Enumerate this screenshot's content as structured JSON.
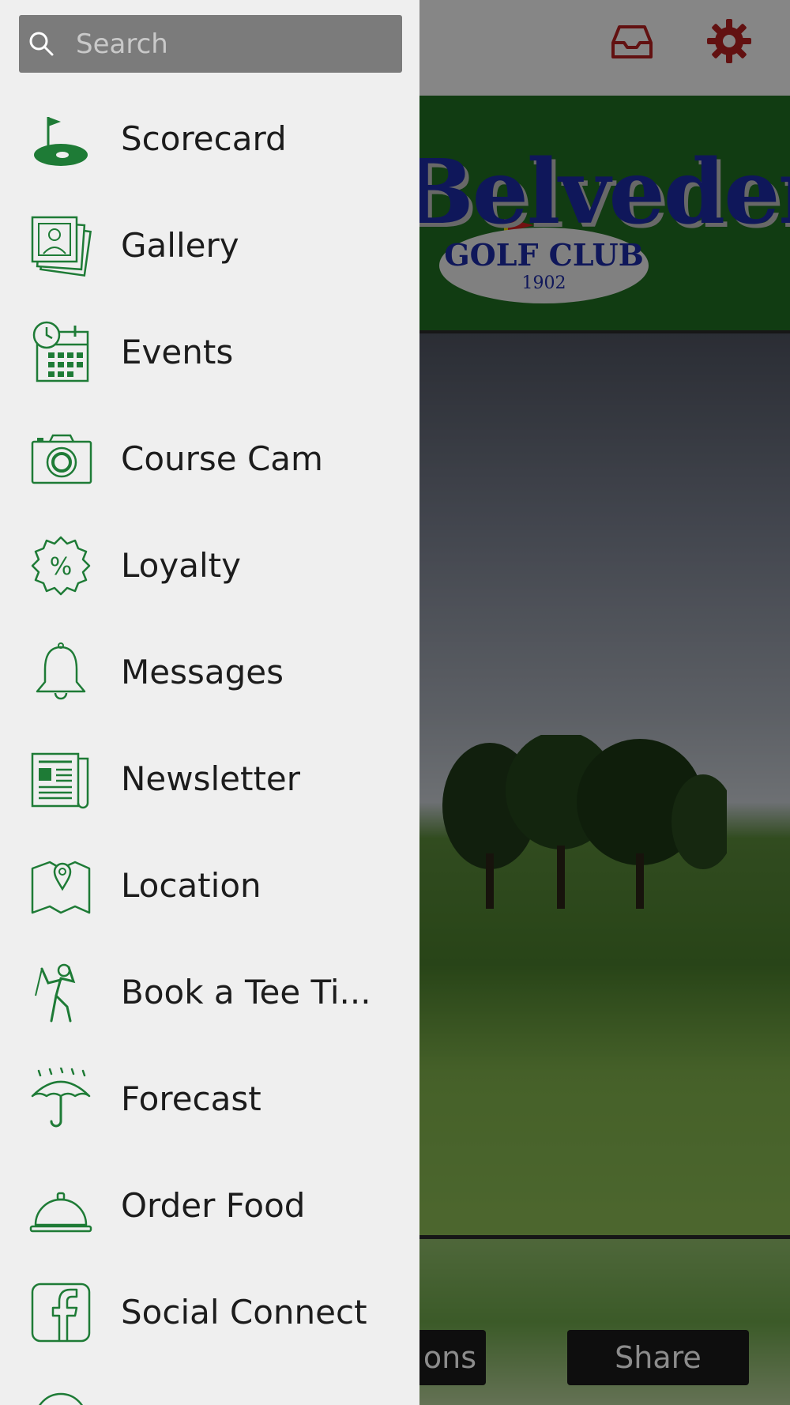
{
  "colors": {
    "accent_green": "#1e7b36",
    "header_icon_red": "#b21f1f",
    "drawer_bg": "#efefef",
    "search_bg": "#7b7b7b"
  },
  "header": {
    "inbox_icon": "inbox-icon",
    "settings_icon": "gear-icon"
  },
  "logo": {
    "wordmark": "Belvedere",
    "club": "GOLF CLUB",
    "year": "1902"
  },
  "search": {
    "placeholder": "Search",
    "value": ""
  },
  "menu": {
    "items": [
      {
        "label": "Scorecard",
        "icon": "golf-hole-flag-icon"
      },
      {
        "label": "Gallery",
        "icon": "photo-gallery-icon"
      },
      {
        "label": "Events",
        "icon": "calendar-clock-icon"
      },
      {
        "label": "Course Cam",
        "icon": "camera-icon"
      },
      {
        "label": "Loyalty",
        "icon": "percent-badge-icon"
      },
      {
        "label": "Messages",
        "icon": "bell-icon"
      },
      {
        "label": "Newsletter",
        "icon": "newspaper-icon"
      },
      {
        "label": "Location",
        "icon": "map-pin-icon"
      },
      {
        "label": "Book a Tee Ti...",
        "icon": "golfer-swing-icon"
      },
      {
        "label": "Forecast",
        "icon": "umbrella-rain-icon"
      },
      {
        "label": "Order Food",
        "icon": "service-bell-icon"
      },
      {
        "label": "Social Connect",
        "icon": "facebook-icon"
      }
    ]
  },
  "footer_buttons": {
    "left_label": "ons",
    "share_label": "Share"
  }
}
